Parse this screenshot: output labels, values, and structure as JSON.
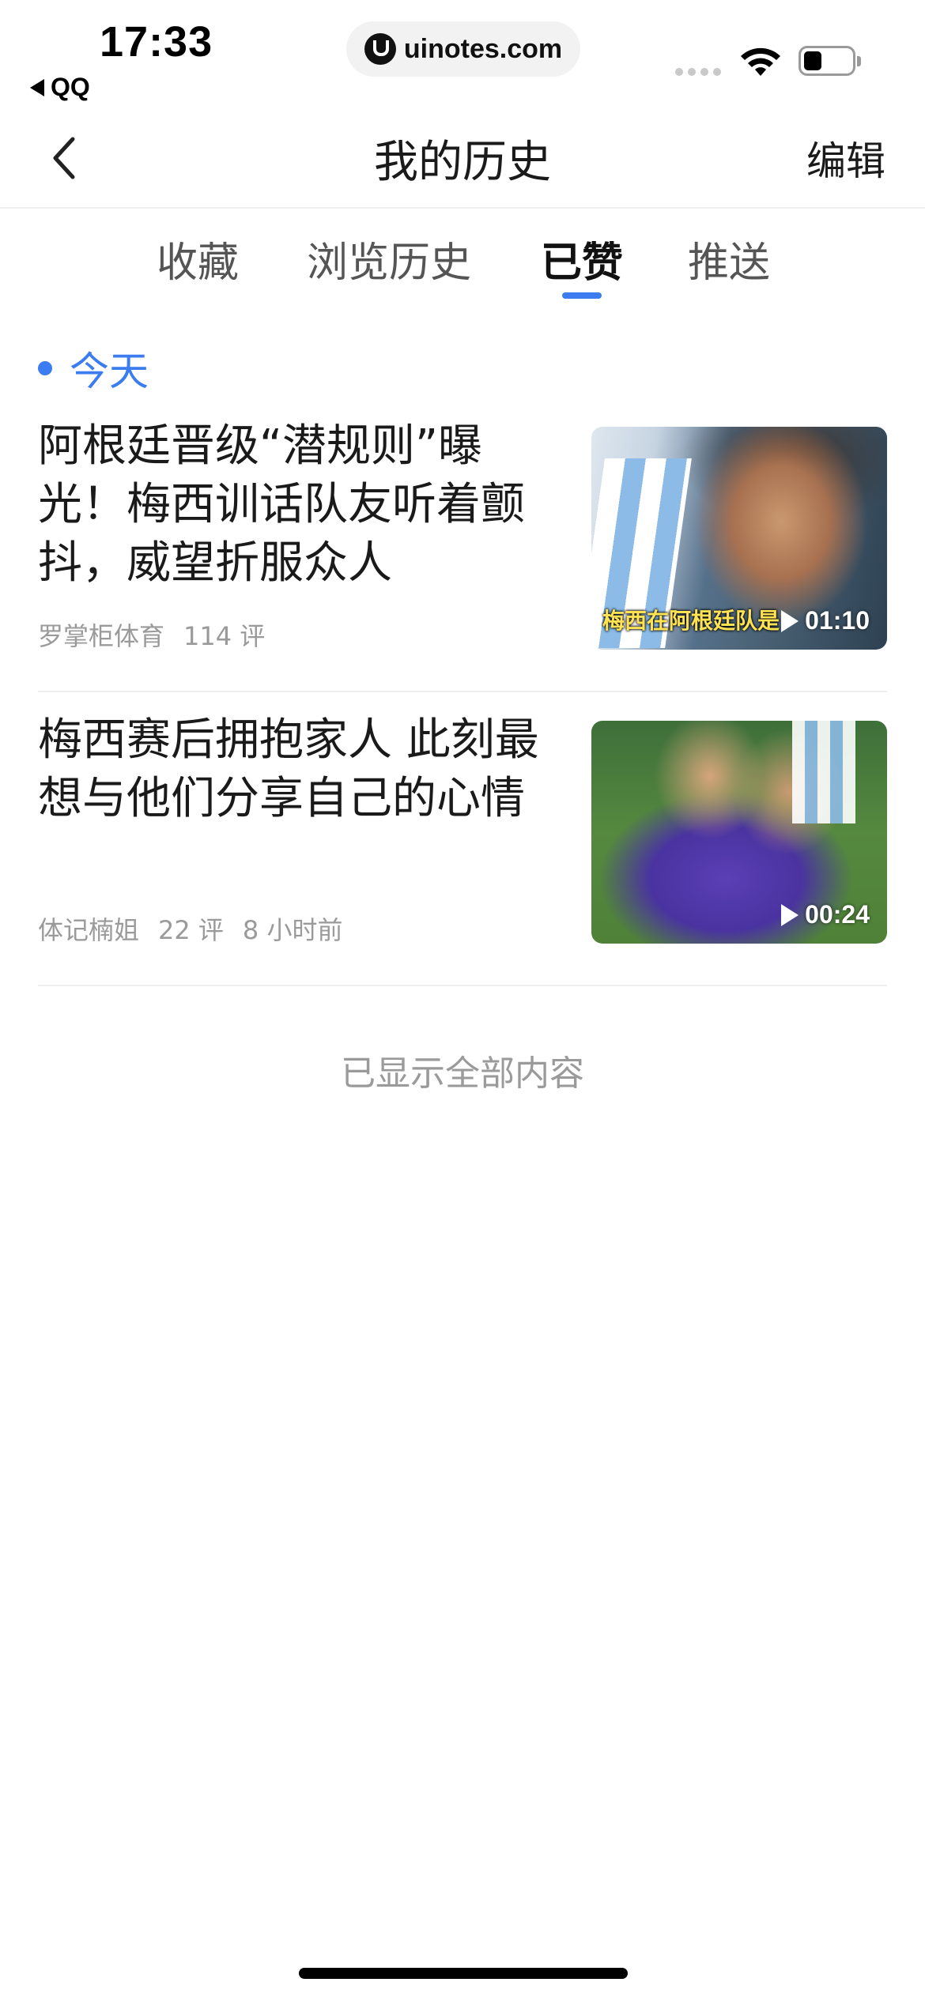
{
  "status_bar": {
    "time": "17:33",
    "back_app": "QQ",
    "url": "uinotes.com",
    "battery_icon": "battery-icon",
    "wifi_icon": "wifi-icon"
  },
  "nav": {
    "title": "我的历史",
    "edit_label": "编辑",
    "back_icon": "chevron-left-icon"
  },
  "tabs": [
    {
      "label": "收藏",
      "active": false
    },
    {
      "label": "浏览历史",
      "active": false
    },
    {
      "label": "已赞",
      "active": true
    },
    {
      "label": "推送",
      "active": false
    }
  ],
  "accent_color": "#3b7cf0",
  "section": {
    "label": "今天"
  },
  "items": [
    {
      "title": "阿根廷晋级“潜规则”曝光！梅西训话队友听着颤抖，威望折服众人",
      "source": "罗掌柜体育",
      "comments": "114 评",
      "time": "",
      "thumb_caption": "梅西在阿根廷队是",
      "duration": "01:10"
    },
    {
      "title": "梅西赛后拥抱家人 此刻最想与他们分享自己的心情",
      "source": "体记楠姐",
      "comments": "22 评",
      "time": "8 小时前",
      "thumb_caption": "",
      "duration": "00:24"
    }
  ],
  "end_text": "已显示全部内容"
}
